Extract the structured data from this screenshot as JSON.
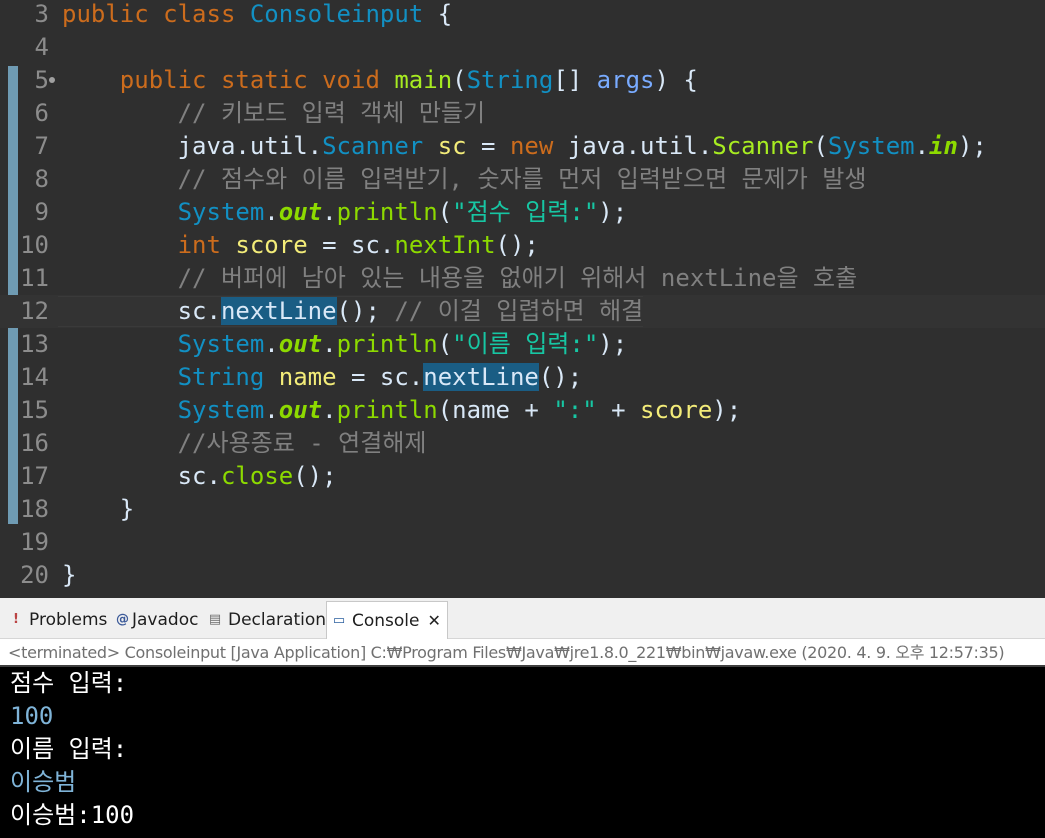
{
  "editor": {
    "current_line": 12,
    "lines": [
      {
        "num": "3",
        "segments": [
          [
            "kw",
            "public"
          ],
          [
            "dflt",
            " "
          ],
          [
            "kw",
            "class"
          ],
          [
            "dflt",
            " "
          ],
          [
            "cls",
            "Consoleinput"
          ],
          [
            "dflt",
            " {"
          ]
        ]
      },
      {
        "num": "4",
        "segments": []
      },
      {
        "num": "5",
        "fold": true,
        "segments": [
          [
            "dflt",
            "    "
          ],
          [
            "kw",
            "public"
          ],
          [
            "dflt",
            " "
          ],
          [
            "kw",
            "static"
          ],
          [
            "dflt",
            " "
          ],
          [
            "kw",
            "void"
          ],
          [
            "dflt",
            " "
          ],
          [
            "mth",
            "main"
          ],
          [
            "dflt",
            "("
          ],
          [
            "cls",
            "String"
          ],
          [
            "dflt",
            "[] "
          ],
          [
            "param",
            "args"
          ],
          [
            "dflt",
            ") {"
          ]
        ]
      },
      {
        "num": "6",
        "segments": [
          [
            "dflt",
            "        "
          ],
          [
            "cmt",
            "// 키보드 입력 객체 만들기"
          ]
        ]
      },
      {
        "num": "7",
        "segments": [
          [
            "dflt",
            "        java.util."
          ],
          [
            "cls",
            "Scanner"
          ],
          [
            "dflt",
            " "
          ],
          [
            "var",
            "sc"
          ],
          [
            "dflt",
            " = "
          ],
          [
            "kw",
            "new"
          ],
          [
            "dflt",
            " java.util."
          ],
          [
            "mth",
            "Scanner"
          ],
          [
            "dflt",
            "("
          ],
          [
            "cls",
            "System"
          ],
          [
            "dflt",
            "."
          ],
          [
            "sfld",
            "in"
          ],
          [
            "dflt",
            ");"
          ]
        ]
      },
      {
        "num": "8",
        "segments": [
          [
            "dflt",
            "        "
          ],
          [
            "cmt",
            "// 점수와 이름 입력받기, 숫자를 먼저 입력받으면 문제가 발생"
          ]
        ]
      },
      {
        "num": "9",
        "segments": [
          [
            "dflt",
            "        "
          ],
          [
            "cls",
            "System"
          ],
          [
            "dflt",
            "."
          ],
          [
            "sfld",
            "out"
          ],
          [
            "dflt",
            "."
          ],
          [
            "fld",
            "println"
          ],
          [
            "dflt",
            "("
          ],
          [
            "str",
            "\"점수 입력:\""
          ],
          [
            "dflt",
            ");"
          ]
        ]
      },
      {
        "num": "10",
        "segments": [
          [
            "dflt",
            "        "
          ],
          [
            "kw",
            "int"
          ],
          [
            "dflt",
            " "
          ],
          [
            "var",
            "score"
          ],
          [
            "dflt",
            " = "
          ],
          [
            "dflt",
            "sc."
          ],
          [
            "fld",
            "nextInt"
          ],
          [
            "dflt",
            "();"
          ]
        ]
      },
      {
        "num": "11",
        "segments": [
          [
            "dflt",
            "        "
          ],
          [
            "cmt",
            "// 버퍼에 남아 있는 내용을 없애기 위해서 nextLine을 호출"
          ]
        ]
      },
      {
        "num": "12",
        "segments": [
          [
            "dflt",
            "        sc."
          ],
          [
            "hl",
            "nextLine"
          ],
          [
            "dflt",
            "(); "
          ],
          [
            "cmt",
            "// 이걸 입렵하면 해결"
          ]
        ]
      },
      {
        "num": "13",
        "segments": [
          [
            "dflt",
            "        "
          ],
          [
            "cls",
            "System"
          ],
          [
            "dflt",
            "."
          ],
          [
            "sfld",
            "out"
          ],
          [
            "dflt",
            "."
          ],
          [
            "fld",
            "println"
          ],
          [
            "dflt",
            "("
          ],
          [
            "str",
            "\"이름 입력:\""
          ],
          [
            "dflt",
            ");"
          ]
        ]
      },
      {
        "num": "14",
        "segments": [
          [
            "dflt",
            "        "
          ],
          [
            "cls",
            "String"
          ],
          [
            "dflt",
            " "
          ],
          [
            "var",
            "name"
          ],
          [
            "dflt",
            " = "
          ],
          [
            "dflt",
            "sc."
          ],
          [
            "hl",
            "nextLine"
          ],
          [
            "dflt",
            "();"
          ]
        ]
      },
      {
        "num": "15",
        "segments": [
          [
            "dflt",
            "        "
          ],
          [
            "cls",
            "System"
          ],
          [
            "dflt",
            "."
          ],
          [
            "sfld",
            "out"
          ],
          [
            "dflt",
            "."
          ],
          [
            "fld",
            "println"
          ],
          [
            "dflt",
            "(name + "
          ],
          [
            "str",
            "\":\""
          ],
          [
            "dflt",
            " + "
          ],
          [
            "var",
            "score"
          ],
          [
            "dflt",
            ");"
          ]
        ]
      },
      {
        "num": "16",
        "segments": [
          [
            "dflt",
            "        "
          ],
          [
            "cmt",
            "//사용종료 - 연결해제"
          ]
        ]
      },
      {
        "num": "17",
        "segments": [
          [
            "dflt",
            "        sc."
          ],
          [
            "fld",
            "close"
          ],
          [
            "dflt",
            "();"
          ]
        ]
      },
      {
        "num": "18",
        "segments": [
          [
            "dflt",
            "    }"
          ]
        ]
      },
      {
        "num": "19",
        "segments": []
      },
      {
        "num": "20",
        "segments": [
          [
            "dflt",
            "}"
          ]
        ]
      }
    ]
  },
  "tabs": [
    {
      "label": "Problems",
      "icon": "problems-icon",
      "glyph": "!"
    },
    {
      "label": "Javadoc",
      "icon": "javadoc-icon",
      "glyph": "@"
    },
    {
      "label": "Declaration",
      "icon": "declaration-icon",
      "glyph": "▤"
    },
    {
      "label": "Console",
      "icon": "console-icon",
      "glyph": "▭",
      "active": true,
      "close": "✕"
    }
  ],
  "console": {
    "status": "<terminated> Consoleinput [Java Application] C:₩Program Files₩Java₩jre1.8.0_221₩bin₩javaw.exe (2020. 4. 9. 오후 12:57:35)",
    "lines": [
      {
        "kind": "out",
        "text": "점수 입력:"
      },
      {
        "kind": "in",
        "text": "100"
      },
      {
        "kind": "out",
        "text": "이름 입력:"
      },
      {
        "kind": "in",
        "text": "이승범"
      },
      {
        "kind": "out",
        "text": "이승범:100"
      }
    ]
  },
  "colors": {
    "editor_bg": "#2f2f2f",
    "keyword": "#cc6c1d",
    "class": "#1290c3",
    "string": "#17c6a3",
    "comment": "#808080",
    "variable": "#f3ec79",
    "occurrence_highlight": "#1a5d84",
    "console_input": "#7fb4d8"
  }
}
